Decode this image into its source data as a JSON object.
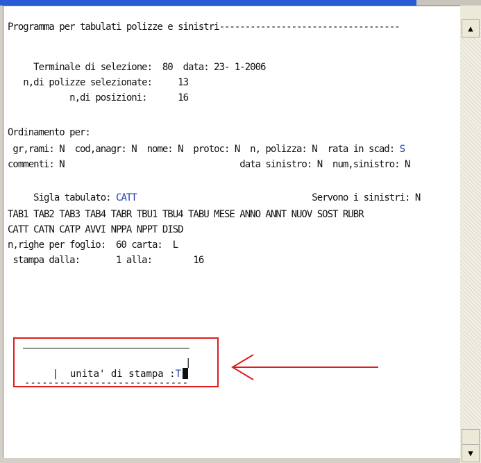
{
  "screen": {
    "lines": [
      "Programma per tabulati polizze e sinistri-----------------------------------",
      "",
      "     Terminale di selezione:  80  data: 23- 1-2006",
      "   n,di polizze selezionate:     13",
      "            n,di posizioni:      16",
      "",
      "Ordinamento per:",
      " gr,rami: N  cod,anagr: N  nome: N  protoc: N  n, polizza: N  rata in scad: S",
      "commenti: N                                  data sinistro: N  num,sinistro: N",
      "",
      "     Sigla tabulato: CATT                                  Servono i sinistri: N",
      "TAB1 TAB2 TAB3 TAB4 TABR TBU1 TBU4 TABU MESE ANNO ANNT NUOV SOST RUBR",
      "CATT CATN CATP AVVI NPPA NPPT DISD",
      "n,righe per foglio:  60 carta:  L",
      " stampa dalla:       1 alla:        16"
    ],
    "prompt_label": "|  unita' di stampa :",
    "prompt_value": "T",
    "prompt_end": "|",
    "prompt_underline": "----------------------------"
  },
  "scrollbar": {
    "up_label": "▲",
    "down_label": "▼"
  },
  "colors": {
    "highlight_box": "#e11b1b",
    "text": "#111111",
    "value_blue": "#1f3ea8"
  }
}
